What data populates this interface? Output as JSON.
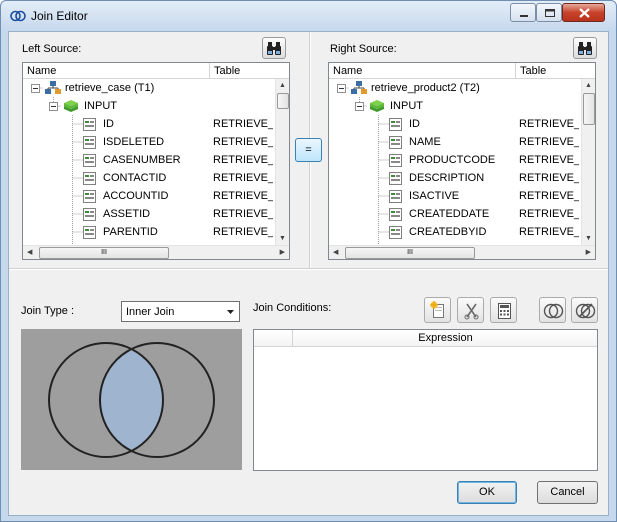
{
  "window": {
    "title": "Join Editor"
  },
  "left": {
    "label": "Left Source:",
    "columns": [
      "Name",
      "Table"
    ],
    "rows": [
      {
        "name": "retrieve_case (T1)",
        "table": "",
        "kind": "source"
      },
      {
        "name": "INPUT",
        "table": "",
        "kind": "input"
      },
      {
        "name": "ID",
        "table": "RETRIEVE_C",
        "kind": "field"
      },
      {
        "name": "ISDELETED",
        "table": "RETRIEVE_C",
        "kind": "field"
      },
      {
        "name": "CASENUMBER",
        "table": "RETRIEVE_C",
        "kind": "field"
      },
      {
        "name": "CONTACTID",
        "table": "RETRIEVE_C",
        "kind": "field"
      },
      {
        "name": "ACCOUNTID",
        "table": "RETRIEVE_C",
        "kind": "field"
      },
      {
        "name": "ASSETID",
        "table": "RETRIEVE_C",
        "kind": "field"
      },
      {
        "name": "PARENTID",
        "table": "RETRIEVE_C",
        "kind": "field"
      }
    ]
  },
  "right": {
    "label": "Right Source:",
    "columns": [
      "Name",
      "Table"
    ],
    "rows": [
      {
        "name": "retrieve_product2 (T2)",
        "table": "",
        "kind": "source"
      },
      {
        "name": "INPUT",
        "table": "",
        "kind": "input"
      },
      {
        "name": "ID",
        "table": "RETRIEVE_P",
        "kind": "field"
      },
      {
        "name": "NAME",
        "table": "RETRIEVE_P",
        "kind": "field"
      },
      {
        "name": "PRODUCTCODE",
        "table": "RETRIEVE_P",
        "kind": "field"
      },
      {
        "name": "DESCRIPTION",
        "table": "RETRIEVE_P",
        "kind": "field"
      },
      {
        "name": "ISACTIVE",
        "table": "RETRIEVE_P",
        "kind": "field"
      },
      {
        "name": "CREATEDDATE",
        "table": "RETRIEVE_P",
        "kind": "field"
      },
      {
        "name": "CREATEDBYID",
        "table": "RETRIEVE_P",
        "kind": "field"
      }
    ]
  },
  "equals_label": "=",
  "scroll_grip": "III",
  "join": {
    "type_label": "Join Type :",
    "type_value": "Inner Join",
    "conditions_label": "Join Conditions:",
    "expression_header": "Expression"
  },
  "buttons": {
    "ok": "OK",
    "cancel": "Cancel"
  },
  "colors": {
    "venn_fill": "#9fb5cf",
    "venn_bg": "#9e9e9e",
    "accent": "#3c7fb1"
  }
}
